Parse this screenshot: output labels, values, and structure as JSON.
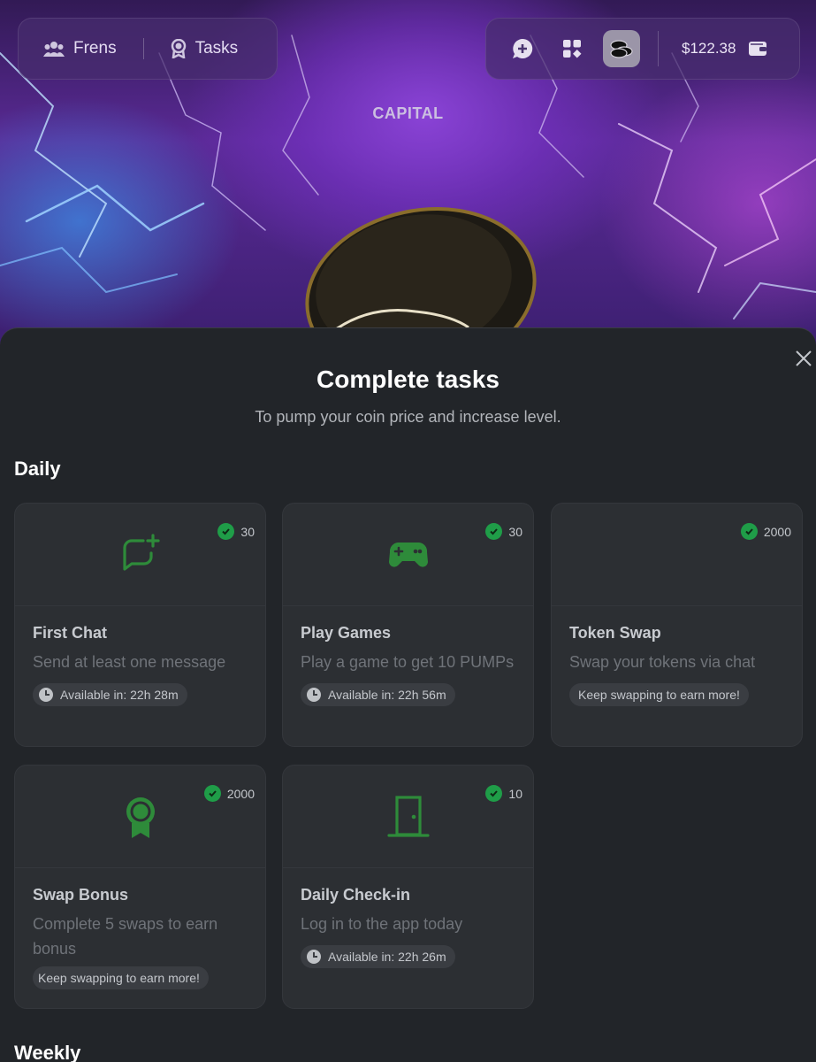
{
  "header": {
    "nav": [
      {
        "label": "Frens",
        "icon": "users-icon"
      },
      {
        "label": "Tasks",
        "icon": "award-icon"
      }
    ],
    "icons": [
      "chat-plus-icon",
      "apps-grid-icon",
      "coins-icon"
    ],
    "balance": "$122.38",
    "wallet_icon": "wallet-icon"
  },
  "hero": {
    "coin_label": "CAPITAL"
  },
  "sheet": {
    "title": "Complete tasks",
    "subtitle": "To pump your coin price and increase level.",
    "sections": [
      {
        "label": "Daily",
        "tasks": [
          {
            "title": "First Chat",
            "description": "Send at least one message",
            "reward": "30",
            "status": "Available in: 22h 28m",
            "icon": "chat-plus-icon"
          },
          {
            "title": "Play Games",
            "description": "Play a game to get 10 PUMPs",
            "reward": "30",
            "status": "Available in: 22h 56m",
            "icon": "gamepad-icon"
          },
          {
            "title": "Token Swap",
            "description": "Swap your tokens via chat",
            "reward": "2000",
            "status": "Keep swapping to earn more!",
            "icon": ""
          },
          {
            "title": "Swap Bonus",
            "description": "Complete 5 swaps to earn bonus",
            "reward": "2000",
            "status": "Keep swapping to earn more!",
            "icon": "ribbon-icon"
          },
          {
            "title": "Daily Check-in",
            "description": "Log in to the app today",
            "reward": "10",
            "status": "Available in: 22h 26m",
            "icon": "door-icon"
          }
        ]
      },
      {
        "label": "Weekly"
      }
    ]
  },
  "colors": {
    "accent_green": "#2e8b3a",
    "check_green": "#1f9d48",
    "sheet_bg": "#222529",
    "card_bg": "#2c2f33"
  }
}
